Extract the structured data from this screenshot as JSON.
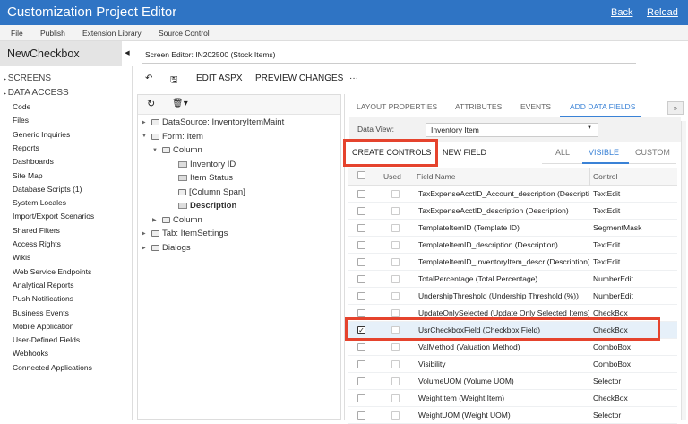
{
  "header": {
    "title": "Customization Project Editor",
    "back": "Back",
    "reload": "Reload"
  },
  "menu": [
    "File",
    "Publish",
    "Extension Library",
    "Source Control"
  ],
  "sidebar": {
    "project": "NewCheckbox",
    "sections": [
      "SCREENS",
      "DATA ACCESS"
    ],
    "items": [
      "Code",
      "Files",
      "Generic Inquiries",
      "Reports",
      "Dashboards",
      "Site Map",
      "Database Scripts (1)",
      "System Locales",
      "Import/Export Scenarios",
      "Shared Filters",
      "Access Rights",
      "Wikis",
      "Web Service Endpoints",
      "Analytical Reports",
      "Push Notifications",
      "Business Events",
      "Mobile Application",
      "User-Defined Fields",
      "Webhooks",
      "Connected Applications"
    ]
  },
  "editor": {
    "label": "Screen Editor: IN202500 (Stock Items)",
    "edit_aspx": "EDIT ASPX",
    "preview": "PREVIEW CHANGES",
    "more": "···"
  },
  "tree": [
    {
      "label": "DataSource: InventoryItemMaint",
      "level": 0,
      "icon": "folder",
      "arrow": "right"
    },
    {
      "label": "Form: Item",
      "level": 0,
      "icon": "folder",
      "arrow": "down"
    },
    {
      "label": "Column",
      "level": 1,
      "icon": "folder",
      "arrow": "down"
    },
    {
      "label": "Inventory ID",
      "level": 2,
      "icon": "field"
    },
    {
      "label": "Item Status",
      "level": 2,
      "icon": "field"
    },
    {
      "label": "[Column Span]",
      "level": 2,
      "icon": "folder"
    },
    {
      "label": "Description",
      "level": 2,
      "icon": "field",
      "bold": true
    },
    {
      "label": "Column",
      "level": 1,
      "icon": "folder",
      "arrow": "right"
    },
    {
      "label": "Tab: ItemSettings",
      "level": 0,
      "icon": "folder",
      "arrow": "right"
    },
    {
      "label": "Dialogs",
      "level": 0,
      "icon": "folder",
      "arrow": "right"
    }
  ],
  "tabs": [
    "LAYOUT PROPERTIES",
    "ATTRIBUTES",
    "EVENTS",
    "ADD DATA FIELDS"
  ],
  "active_tab": "ADD DATA FIELDS",
  "data_view": {
    "label": "Data View:",
    "value": "Inventory Item"
  },
  "actions": {
    "create": "CREATE CONTROLS",
    "new_field": "NEW FIELD"
  },
  "filters": [
    "ALL",
    "VISIBLE",
    "CUSTOM"
  ],
  "active_filter": "VISIBLE",
  "table": {
    "headers": [
      "Used",
      "Field Name",
      "Control"
    ],
    "rows": [
      {
        "field": "TaxExpenseAcctID_Account_description (Description)",
        "control": "TextEdit",
        "checked": false
      },
      {
        "field": "TaxExpenseAcctID_description (Description)",
        "control": "TextEdit",
        "checked": false
      },
      {
        "field": "TemplateItemID (Template ID)",
        "control": "SegmentMask",
        "checked": false
      },
      {
        "field": "TemplateItemID_description (Description)",
        "control": "TextEdit",
        "checked": false
      },
      {
        "field": "TemplateItemID_InventoryItem_descr (Description)",
        "control": "TextEdit",
        "checked": false
      },
      {
        "field": "TotalPercentage (Total Percentage)",
        "control": "NumberEdit",
        "checked": false
      },
      {
        "field": "UndershipThreshold (Undership Threshold (%))",
        "control": "NumberEdit",
        "checked": false
      },
      {
        "field": "UpdateOnlySelected (Update Only Selected Items)",
        "control": "CheckBox",
        "checked": false
      },
      {
        "field": "UsrCheckboxField (Checkbox Field)",
        "control": "CheckBox",
        "checked": true
      },
      {
        "field": "ValMethod (Valuation Method)",
        "control": "ComboBox",
        "checked": false
      },
      {
        "field": "Visibility",
        "control": "ComboBox",
        "checked": false
      },
      {
        "field": "VolumeUOM (Volume UOM)",
        "control": "Selector",
        "checked": false
      },
      {
        "field": "WeightItem (Weight Item)",
        "control": "CheckBox",
        "checked": false
      },
      {
        "field": "WeightUOM (Weight UOM)",
        "control": "Selector",
        "checked": false
      }
    ]
  },
  "colors": {
    "header": "#2f74c4",
    "accent": "#3a82d6",
    "highlight": "#e5432d"
  }
}
